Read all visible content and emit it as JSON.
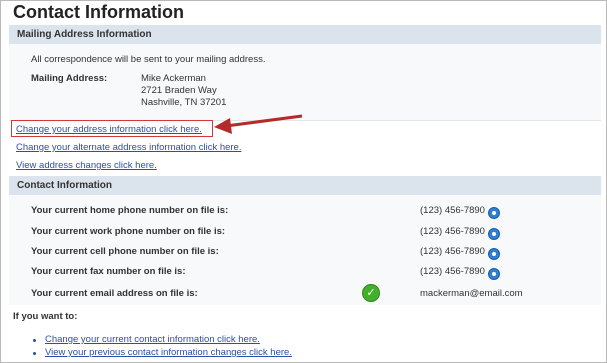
{
  "page": {
    "title": "Contact Information"
  },
  "mailing": {
    "header": "Mailing Address Information",
    "note": "All correspondence will be sent to your mailing address.",
    "label": "Mailing Address:",
    "address": [
      "Mike Ackerman",
      "2721 Braden Way",
      "Nashville, TN 37201"
    ]
  },
  "links": {
    "change_address": "Change your address information click here.",
    "change_alternate": "Change your alternate address information click here.",
    "view_changes": "View address changes click here."
  },
  "contact": {
    "header": "Contact Information",
    "rows": [
      {
        "label": "Your current home phone number on file is:",
        "value": "(123) 456-7890"
      },
      {
        "label": "Your current work phone number on file is:",
        "value": "(123) 456-7890"
      },
      {
        "label": "Your current cell phone number on file is:",
        "value": "(123) 456-7890"
      },
      {
        "label": "Your current fax number on file is:",
        "value": "(123) 456-7890"
      },
      {
        "label": "Your current email address on file is:",
        "value": "mackerman@email.com"
      }
    ]
  },
  "footer": {
    "prompt": "If you want to:",
    "links": [
      "Change your current contact information click here.",
      "View your previous contact information changes click here."
    ]
  },
  "colors": {
    "header_bg": "#dbe3ec",
    "link": "#2a4fa8",
    "highlight": "#d23a3a",
    "check": "#44b02a"
  }
}
